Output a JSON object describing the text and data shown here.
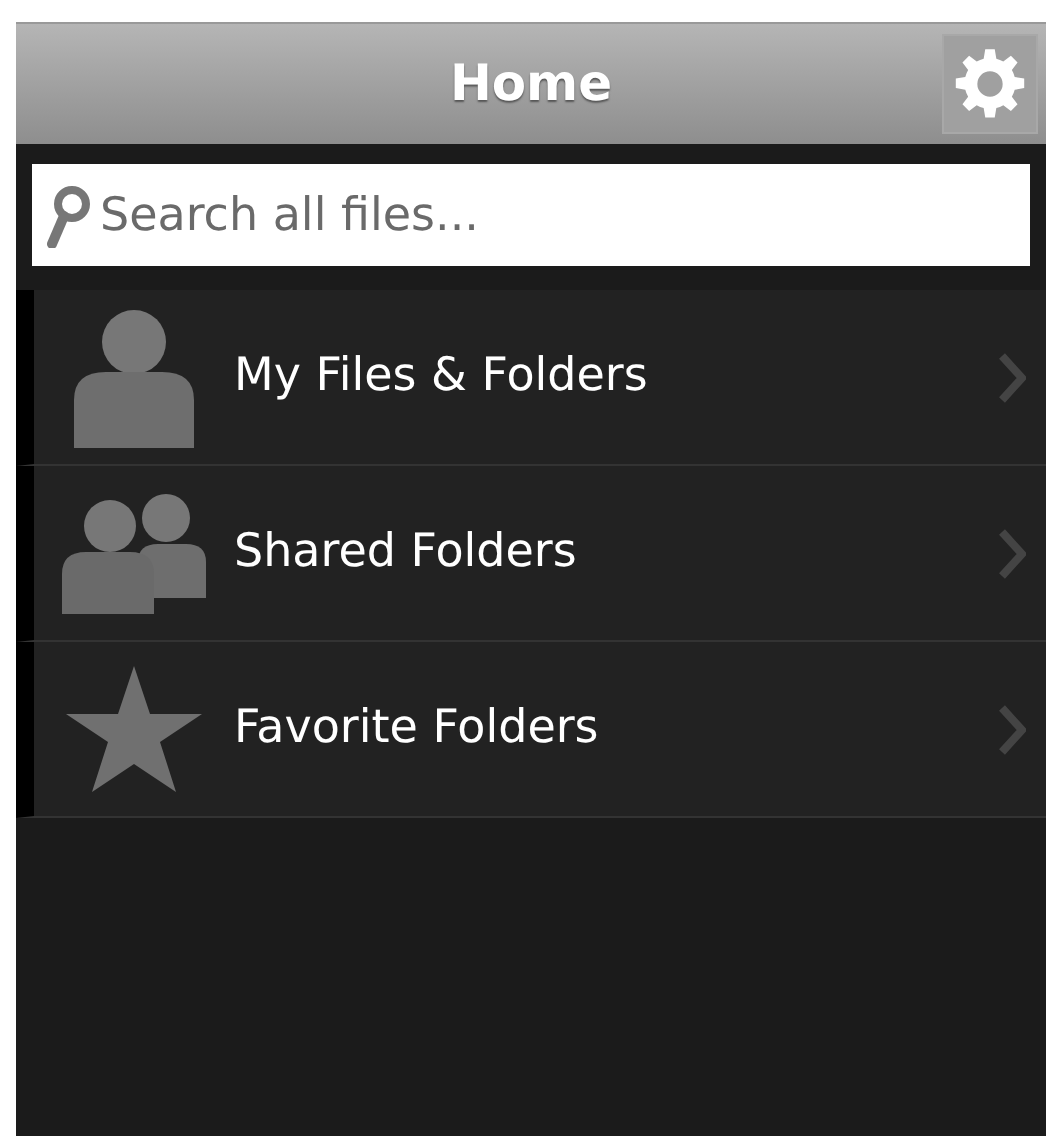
{
  "header": {
    "title": "Home"
  },
  "search": {
    "placeholder": "Search all files..."
  },
  "menu": [
    {
      "kind": "person",
      "label": "My Files & Folders"
    },
    {
      "kind": "people",
      "label": "Shared Folders"
    },
    {
      "kind": "star",
      "label": "Favorite Folders"
    }
  ]
}
